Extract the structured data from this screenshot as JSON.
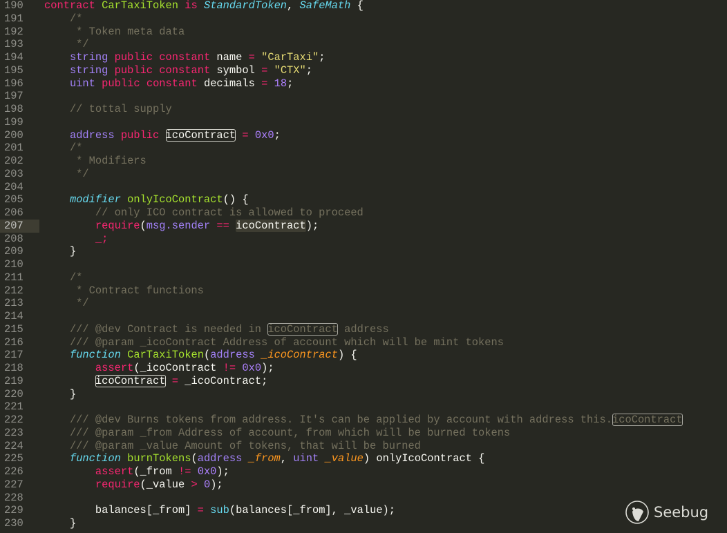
{
  "editor": {
    "current_line": "207",
    "lines": [
      {
        "num": "190",
        "tokens": [
          [
            "k",
            "contract"
          ],
          [
            "w",
            " "
          ],
          [
            "f",
            "CarTaxiToken"
          ],
          [
            "w",
            " "
          ],
          [
            "k",
            "is"
          ],
          [
            "w",
            " "
          ],
          [
            "i",
            "StandardToken"
          ],
          [
            "w",
            ", "
          ],
          [
            "i",
            "SafeMath"
          ],
          [
            "w",
            " {"
          ]
        ]
      },
      {
        "num": "191",
        "tokens": [
          [
            "c",
            "    /*"
          ]
        ]
      },
      {
        "num": "192",
        "tokens": [
          [
            "c",
            "     * Token meta data"
          ]
        ]
      },
      {
        "num": "193",
        "tokens": [
          [
            "c",
            "     */"
          ]
        ]
      },
      {
        "num": "194",
        "tokens": [
          [
            "w",
            "    "
          ],
          [
            "t",
            "string"
          ],
          [
            "w",
            " "
          ],
          [
            "k",
            "public"
          ],
          [
            "w",
            " "
          ],
          [
            "k",
            "constant"
          ],
          [
            "w",
            " name "
          ],
          [
            "k",
            "="
          ],
          [
            "w",
            " "
          ],
          [
            "s",
            "\"CarTaxi\""
          ],
          [
            "w",
            ";"
          ]
        ]
      },
      {
        "num": "195",
        "tokens": [
          [
            "w",
            "    "
          ],
          [
            "t",
            "string"
          ],
          [
            "w",
            " "
          ],
          [
            "k",
            "public"
          ],
          [
            "w",
            " "
          ],
          [
            "k",
            "constant"
          ],
          [
            "w",
            " symbol "
          ],
          [
            "k",
            "="
          ],
          [
            "w",
            " "
          ],
          [
            "s",
            "\"CTX\""
          ],
          [
            "w",
            ";"
          ]
        ]
      },
      {
        "num": "196",
        "tokens": [
          [
            "w",
            "    "
          ],
          [
            "t",
            "uint"
          ],
          [
            "w",
            " "
          ],
          [
            "k",
            "public"
          ],
          [
            "w",
            " "
          ],
          [
            "k",
            "constant"
          ],
          [
            "w",
            " decimals "
          ],
          [
            "k",
            "="
          ],
          [
            "w",
            " "
          ],
          [
            "n",
            "18"
          ],
          [
            "w",
            ";"
          ]
        ]
      },
      {
        "num": "197",
        "tokens": []
      },
      {
        "num": "198",
        "tokens": [
          [
            "c",
            "    // tottal supply"
          ]
        ]
      },
      {
        "num": "199",
        "tokens": []
      },
      {
        "num": "200",
        "tokens": [
          [
            "w",
            "    "
          ],
          [
            "t",
            "address"
          ],
          [
            "w",
            " "
          ],
          [
            "k",
            "public"
          ],
          [
            "w",
            " "
          ],
          [
            "box",
            "icoContract"
          ],
          [
            "w",
            " "
          ],
          [
            "k",
            "="
          ],
          [
            "w",
            " "
          ],
          [
            "n",
            "0x0"
          ],
          [
            "w",
            ";"
          ]
        ]
      },
      {
        "num": "201",
        "tokens": [
          [
            "c",
            "    /*"
          ]
        ]
      },
      {
        "num": "202",
        "tokens": [
          [
            "c",
            "     * Modifiers"
          ]
        ]
      },
      {
        "num": "203",
        "tokens": [
          [
            "c",
            "     */"
          ]
        ]
      },
      {
        "num": "204",
        "tokens": []
      },
      {
        "num": "205",
        "tokens": [
          [
            "w",
            "    "
          ],
          [
            "i",
            "modifier"
          ],
          [
            "w",
            " "
          ],
          [
            "f",
            "onlyIcoContract"
          ],
          [
            "w",
            "() {"
          ]
        ]
      },
      {
        "num": "206",
        "tokens": [
          [
            "c",
            "        // only ICO contract is allowed to proceed"
          ]
        ]
      },
      {
        "num": "207",
        "tokens": [
          [
            "w",
            "        "
          ],
          [
            "k",
            "require"
          ],
          [
            "w",
            "("
          ],
          [
            "t",
            "msg.sender"
          ],
          [
            "w",
            " "
          ],
          [
            "k",
            "=="
          ],
          [
            "w",
            " "
          ],
          [
            "hl",
            "icoContract"
          ],
          [
            "w",
            ");"
          ]
        ]
      },
      {
        "num": "208",
        "tokens": [
          [
            "w",
            "        "
          ],
          [
            "k",
            "_;"
          ]
        ]
      },
      {
        "num": "209",
        "tokens": [
          [
            "w",
            "    }"
          ]
        ]
      },
      {
        "num": "210",
        "tokens": []
      },
      {
        "num": "211",
        "tokens": [
          [
            "c",
            "    /*"
          ]
        ]
      },
      {
        "num": "212",
        "tokens": [
          [
            "c",
            "     * Contract functions"
          ]
        ]
      },
      {
        "num": "213",
        "tokens": [
          [
            "c",
            "     */"
          ]
        ]
      },
      {
        "num": "214",
        "tokens": []
      },
      {
        "num": "215",
        "tokens": [
          [
            "c",
            "    /// @dev Contract is needed in "
          ],
          [
            "cbox",
            "icoContract"
          ],
          [
            "c",
            " address"
          ]
        ]
      },
      {
        "num": "216",
        "tokens": [
          [
            "c",
            "    /// @param _icoContract Address of account which will be mint tokens"
          ]
        ]
      },
      {
        "num": "217",
        "tokens": [
          [
            "w",
            "    "
          ],
          [
            "i",
            "function"
          ],
          [
            "w",
            " "
          ],
          [
            "f",
            "CarTaxiToken"
          ],
          [
            "w",
            "("
          ],
          [
            "t",
            "address"
          ],
          [
            "w",
            " "
          ],
          [
            "p",
            "_icoContract"
          ],
          [
            "w",
            ") {"
          ]
        ]
      },
      {
        "num": "218",
        "tokens": [
          [
            "w",
            "        "
          ],
          [
            "k",
            "assert"
          ],
          [
            "w",
            "(_icoContract "
          ],
          [
            "k",
            "!="
          ],
          [
            "w",
            " "
          ],
          [
            "n",
            "0x0"
          ],
          [
            "w",
            ");"
          ]
        ]
      },
      {
        "num": "219",
        "tokens": [
          [
            "w",
            "        "
          ],
          [
            "box",
            "icoContract"
          ],
          [
            "w",
            " "
          ],
          [
            "k",
            "="
          ],
          [
            "w",
            " _icoContract;"
          ]
        ]
      },
      {
        "num": "220",
        "tokens": [
          [
            "w",
            "    }"
          ]
        ]
      },
      {
        "num": "221",
        "tokens": []
      },
      {
        "num": "222",
        "tokens": [
          [
            "c",
            "    /// @dev Burns tokens from address. It's can be applied by account with address this."
          ],
          [
            "cbox",
            "icoContract"
          ]
        ]
      },
      {
        "num": "223",
        "tokens": [
          [
            "c",
            "    /// @param _from Address of account, from which will be burned tokens"
          ]
        ]
      },
      {
        "num": "224",
        "tokens": [
          [
            "c",
            "    /// @param _value Amount of tokens, that will be burned"
          ]
        ]
      },
      {
        "num": "225",
        "tokens": [
          [
            "w",
            "    "
          ],
          [
            "i",
            "function"
          ],
          [
            "w",
            " "
          ],
          [
            "f",
            "burnTokens"
          ],
          [
            "w",
            "("
          ],
          [
            "t",
            "address"
          ],
          [
            "w",
            " "
          ],
          [
            "p",
            "_from"
          ],
          [
            "w",
            ", "
          ],
          [
            "t",
            "uint"
          ],
          [
            "w",
            " "
          ],
          [
            "p",
            "_value"
          ],
          [
            "w",
            ") onlyIcoContract {"
          ]
        ]
      },
      {
        "num": "226",
        "tokens": [
          [
            "w",
            "        "
          ],
          [
            "k",
            "assert"
          ],
          [
            "w",
            "(_from "
          ],
          [
            "k",
            "!="
          ],
          [
            "w",
            " "
          ],
          [
            "n",
            "0x0"
          ],
          [
            "w",
            ");"
          ]
        ]
      },
      {
        "num": "227",
        "tokens": [
          [
            "w",
            "        "
          ],
          [
            "k",
            "require"
          ],
          [
            "w",
            "(_value "
          ],
          [
            "k",
            ">"
          ],
          [
            "w",
            " "
          ],
          [
            "n",
            "0"
          ],
          [
            "w",
            ");"
          ]
        ]
      },
      {
        "num": "228",
        "tokens": []
      },
      {
        "num": "229",
        "tokens": [
          [
            "w",
            "        balances[_from] "
          ],
          [
            "k",
            "="
          ],
          [
            "w",
            " "
          ],
          [
            "b",
            "sub"
          ],
          [
            "w",
            "(balances[_from], _value);"
          ]
        ]
      },
      {
        "num": "230",
        "tokens": [
          [
            "w",
            "    }"
          ]
        ]
      }
    ]
  },
  "watermark": {
    "text": "Seebug",
    "icon": "seebug-ladybug-icon"
  },
  "colors": {
    "background": "#272822",
    "keyword": "#f92672",
    "type": "#a281f7",
    "comment": "#75715e",
    "function": "#a6e22e",
    "string": "#e6db74",
    "param": "#fd971f"
  }
}
